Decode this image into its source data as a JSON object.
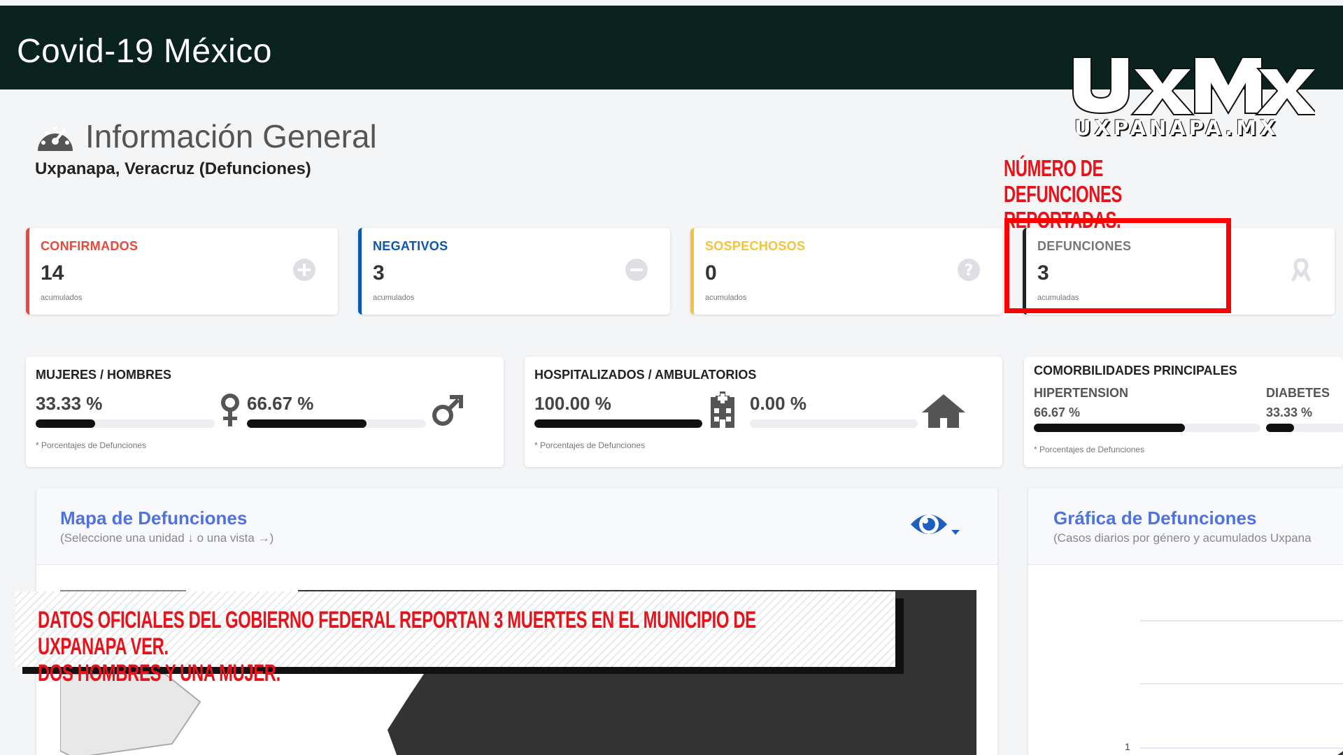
{
  "header": {
    "title": "Covid-19 México"
  },
  "logo": {
    "mark": "UxMx",
    "site": "UXPANAPA.MX"
  },
  "section": {
    "title": "Información General",
    "subtitle": "Uxpanapa, Veracruz (Defunciones)"
  },
  "annotations": {
    "top": "NÚMERO DE DEFUNCIONES REPORTADAS.",
    "banner_line1": "DATOS OFICIALES DEL GOBIERNO FEDERAL REPORTAN 3 MUERTES EN EL MUNICIPIO DE UXPANAPA VER.",
    "banner_line2": "DOS HOMBRES Y UNA MUJER."
  },
  "cards": [
    {
      "label": "CONFIRMADOS",
      "value": "14",
      "note": "acumulados",
      "icon": "plus-circle-icon",
      "color": "#e74a3b"
    },
    {
      "label": "NEGATIVOS",
      "value": "3",
      "note": "acumulados",
      "icon": "minus-circle-icon",
      "color": "#0c57b0"
    },
    {
      "label": "SOSPECHOSOS",
      "value": "0",
      "note": "acumulados",
      "icon": "question-circle-icon",
      "color": "#f6c23e"
    },
    {
      "label": "DEFUNCIONES",
      "value": "3",
      "note": "acumuladas",
      "icon": "ribbon-icon",
      "color": "#222222"
    }
  ],
  "panels": {
    "gender": {
      "title": "MUJERES / HOMBRES",
      "women_pct": "33.33 %",
      "women_fraction": 0.3333,
      "men_pct": "66.67 %",
      "men_fraction": 0.6667,
      "note": "* Porcentajes  de Defunciones"
    },
    "hospital": {
      "title": "HOSPITALIZADOS / AMBULATORIOS",
      "hosp_pct": "100.00 %",
      "hosp_fraction": 1.0,
      "amb_pct": "0.00 %",
      "amb_fraction": 0.0,
      "note": "* Porcentajes  de Defunciones"
    },
    "comorbid": {
      "title": "COMORBILIDADES PRINCIPALES",
      "items": [
        {
          "name": "HIPERTENSION",
          "pct": "66.67 %",
          "fraction": 0.6667
        },
        {
          "name": "DIABETES",
          "pct": "33.33 %",
          "fraction": 0.3333
        }
      ],
      "note": "* Porcentajes  de Defunciones"
    }
  },
  "map": {
    "title": "Mapa de Defunciones",
    "subtitle": "(Seleccione una unidad ↓ o una vista →)",
    "view_icon": "eye-icon"
  },
  "chart": {
    "title": "Gráfica de Defunciones",
    "subtitle": "(Casos diarios por género y acumulados Uxpana",
    "tick": "1"
  },
  "colors": {
    "header_bg": "#0b231e",
    "annotation_red": "#e8121b",
    "link_blue": "#4e73df"
  }
}
